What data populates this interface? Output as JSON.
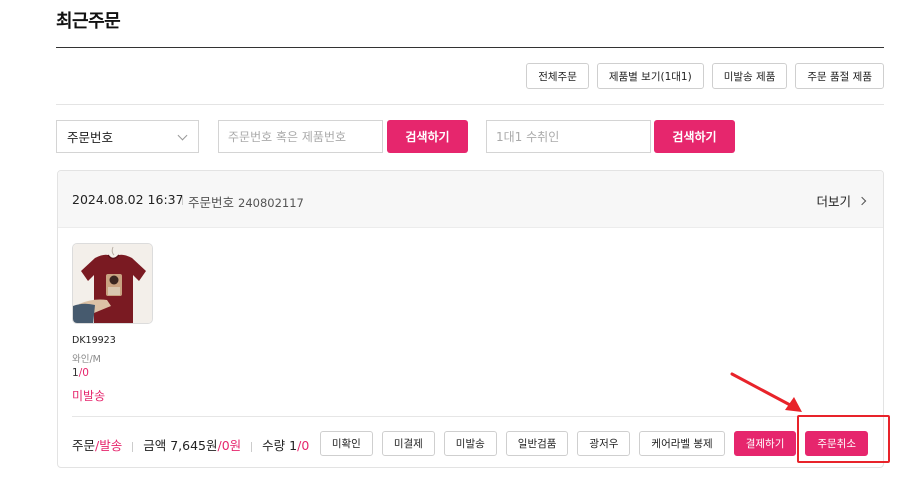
{
  "page": {
    "title": "최근주문"
  },
  "filters": {
    "all_orders": "전체주문",
    "by_product": "제품별 보기(1대1)",
    "unshipped": "미발송 제품",
    "out_of_stock": "주문 품절 제품"
  },
  "search": {
    "select_value": "주문번호",
    "query_placeholder": "주문번호 혹은 제품번호",
    "search_button": "검색하기",
    "recipient_placeholder": "1대1 수취인",
    "search_button_2": "검색하기"
  },
  "order": {
    "date": "2024.08.02 16:37",
    "order_label": "주문번호",
    "order_number": "240802117",
    "more_label": "더보기",
    "product": {
      "code": "DK19923",
      "option": "와인/M",
      "qty_total": "1",
      "qty_sep": "/",
      "qty_sent": "0",
      "status": "미발송"
    },
    "summary": {
      "order_label": "주문",
      "order_sep": "/",
      "shipping_label": "발송",
      "amount_label": "금액",
      "amount_value": "7,645원",
      "amount_sep": "/",
      "amount_sent": "0원",
      "qty_label": "수량",
      "qty_total": "1",
      "qty_sep": "/",
      "qty_sent": "0"
    },
    "actions": [
      "미확인",
      "미결제",
      "미발송",
      "일반검품",
      "광저우",
      "케어라벨 봉제"
    ],
    "pay_button": "결제하기",
    "cancel_button": "주문취소"
  },
  "colors": {
    "accent": "#e6266d",
    "annotation": "#e8232a",
    "shirt": "#7a1a22"
  },
  "icons": {
    "dropdown": "chevron-down-icon",
    "more": "chevron-right-icon"
  }
}
